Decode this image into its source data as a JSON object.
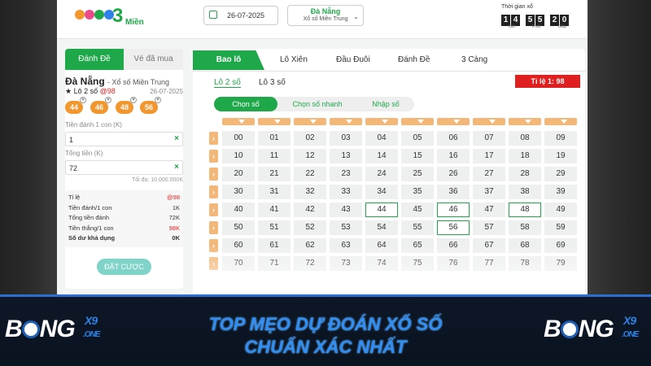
{
  "header": {
    "logo_mien": "Miền",
    "logo_three": "3",
    "date": "26-07-2025",
    "region": "Đà Nẵng",
    "region_sub": "Xổ số Miền Trung",
    "timer_label": "Thời gian xổ",
    "timer_digits": [
      "1",
      "4",
      "5",
      "5",
      "2",
      "0"
    ],
    "timer_units": {
      "hours": "Giờ",
      "minutes": "Phút",
      "seconds": "Giây"
    }
  },
  "left_panel": {
    "tab_bet": "Đánh Đề",
    "tab_bought": "Vé đã mua",
    "region": "Đà Nẵng",
    "region_sub": "- Xổ số Miền Trung",
    "lo_label": "★ Lô 2 số",
    "lo_rate": "@98",
    "date": "26-07-2025",
    "chips": [
      "44",
      "46",
      "48",
      "56"
    ],
    "bet_label": "Tiền đánh 1 con (K)",
    "bet_value": "1",
    "total_label": "Tổng tiền (K)",
    "total_value": "72",
    "max_note": "Tối đa: 10.000.000K",
    "info": [
      {
        "label": "Tỉ lệ",
        "value": "@98",
        "red": true
      },
      {
        "label": "Tiền đánh/1 con",
        "value": "1K",
        "red": false
      },
      {
        "label": "Tổng tiền đánh",
        "value": "72K",
        "red": false
      },
      {
        "label": "Tiền thắng/1 con",
        "value": "98K",
        "red": true
      },
      {
        "label": "Số dư khả dụng",
        "value": "0K",
        "red": false,
        "bold": true
      }
    ],
    "submit": "ĐẶT CƯỢC"
  },
  "main": {
    "tabs": [
      "Bao lô",
      "Lô Xiên",
      "Đầu Đuôi",
      "Đánh Đề",
      "3 Càng"
    ],
    "subtabs": [
      "Lô 2 số",
      "Lô 3 số"
    ],
    "odds": "Tỉ lệ 1: 98",
    "modes": [
      "Chọn số",
      "Chọn số nhanh",
      "Nhập số"
    ],
    "selected": [
      "44",
      "46",
      "48",
      "56"
    ]
  },
  "banner": {
    "brand": "B",
    "brand_rest": "NG",
    "brand_x9": "X9",
    "brand_one": ".ONE",
    "line1": "TOP MẸO DỰ ĐOÁN XỔ SỐ",
    "line2": "CHUẨN XÁC NHẤT"
  }
}
